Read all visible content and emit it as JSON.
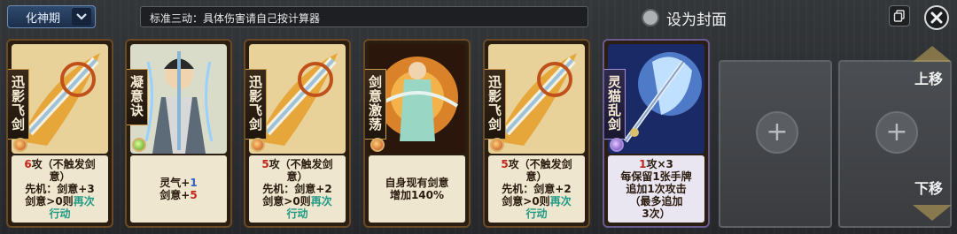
{
  "header": {
    "realm_label": "化神期",
    "description": "标准三动：具体伤害请自己按计算器",
    "cover_label": "设为封面"
  },
  "cards": [
    {
      "name": "迅影飞剑",
      "gem": "orange",
      "lines": [
        {
          "parts": [
            {
              "t": "6",
              "c": "red"
            },
            {
              "t": "攻（不触发剑"
            }
          ]
        },
        {
          "parts": [
            {
              "t": "意）"
            }
          ]
        },
        {
          "parts": [
            {
              "t": "先机：剑意+3"
            }
          ]
        },
        {
          "parts": [
            {
              "t": "剑意>0则"
            },
            {
              "t": "再次",
              "c": "teal"
            }
          ]
        },
        {
          "parts": [
            {
              "t": "行动",
              "c": "teal"
            }
          ]
        }
      ]
    },
    {
      "name": "凝意诀",
      "gem": "green",
      "lines": [
        {
          "parts": [
            {
              "t": "灵气+"
            },
            {
              "t": "1",
              "c": "blue"
            }
          ]
        },
        {
          "parts": [
            {
              "t": "剑意+"
            },
            {
              "t": "5",
              "c": "red"
            }
          ]
        }
      ]
    },
    {
      "name": "迅影飞剑",
      "gem": "orange",
      "lines": [
        {
          "parts": [
            {
              "t": "5",
              "c": "red"
            },
            {
              "t": "攻（不触发剑"
            }
          ]
        },
        {
          "parts": [
            {
              "t": "意）"
            }
          ]
        },
        {
          "parts": [
            {
              "t": "先机：剑意+2"
            }
          ]
        },
        {
          "parts": [
            {
              "t": "剑意>0则"
            },
            {
              "t": "再次",
              "c": "teal"
            }
          ]
        },
        {
          "parts": [
            {
              "t": "行动",
              "c": "teal"
            }
          ]
        }
      ]
    },
    {
      "name": "剑意激荡",
      "gem": "orange",
      "lines": [
        {
          "parts": [
            {
              "t": "自身现有剑意"
            }
          ]
        },
        {
          "parts": [
            {
              "t": "增加140%"
            }
          ]
        }
      ]
    },
    {
      "name": "迅影飞剑",
      "gem": "orange",
      "lines": [
        {
          "parts": [
            {
              "t": "5",
              "c": "red"
            },
            {
              "t": "攻（不触发剑"
            }
          ]
        },
        {
          "parts": [
            {
              "t": "意）"
            }
          ]
        },
        {
          "parts": [
            {
              "t": "先机：剑意+2"
            }
          ]
        },
        {
          "parts": [
            {
              "t": "剑意>0则"
            },
            {
              "t": "再次",
              "c": "teal"
            }
          ]
        },
        {
          "parts": [
            {
              "t": "行动",
              "c": "teal"
            }
          ]
        }
      ]
    },
    {
      "name": "灵猫乱剑",
      "gem": "purple",
      "lines": [
        {
          "parts": [
            {
              "t": "1",
              "c": "red"
            },
            {
              "t": "攻×3"
            }
          ]
        },
        {
          "parts": [
            {
              "t": "每保留1张手牌"
            }
          ]
        },
        {
          "parts": [
            {
              "t": "追加1次攻击"
            }
          ]
        },
        {
          "parts": [
            {
              "t": "（最多追加"
            }
          ]
        },
        {
          "parts": [
            {
              "t": "3次）"
            }
          ]
        }
      ]
    }
  ],
  "slots": {
    "plus_glyph": "+"
  },
  "side": {
    "up_label": "上移",
    "down_label": "下移"
  }
}
